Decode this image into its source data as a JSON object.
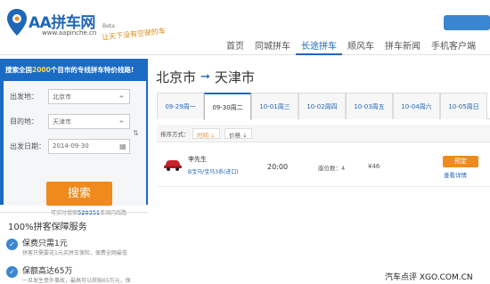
{
  "header": {
    "logo_name": "AA拼车网",
    "logo_url": "www.aapinche.cn",
    "beta": "Beta",
    "slogan": "让天下没有空驶的车",
    "nav": [
      "首页",
      "同城拼车",
      "长途拼车",
      "顺风车",
      "拼车新闻",
      "手机客户端"
    ],
    "active_nav": "长途拼车"
  },
  "sidebar": {
    "title_pre": "搜索全国",
    "title_num": "2000",
    "title_post": "个目市的专线拼车特价线路!",
    "from_label": "出发地：",
    "from_value": "北京市",
    "to_label": "目的地：",
    "to_value": "天津市",
    "date_label": "出发日期：",
    "date_value": "2014-09-30",
    "search_label": "搜索",
    "note_pre": "可实时搜索",
    "note_num": "520351",
    "note_post": "条国内线路"
  },
  "guarantee": {
    "title": "100%拼客保障服务",
    "items": [
      {
        "head": "保费只需1元",
        "sub": "拼客只需要花1元买拼车保险，保费全网最低"
      },
      {
        "head": "保额高达65万",
        "sub": "一旦发生意外事故，最高可以获赔65万元，保"
      }
    ]
  },
  "route": {
    "from": "北京市",
    "to": "天津市"
  },
  "dates": [
    "09-29周一",
    "09-30周二",
    "10-01周三",
    "10-02周四",
    "10-03周五",
    "10-04周六",
    "10-05周日"
  ],
  "active_date": "09-30周二",
  "sort": {
    "label": "排序方式：",
    "time": "时间 ⇣",
    "price": "价格 ⇣"
  },
  "listing": {
    "driver": "李先生",
    "vehicle": "B宝马/宝马3系(进口)",
    "time": "20:00",
    "seats": "座位数：4",
    "price": "¥46",
    "book": "预定",
    "detail": "查看详情"
  },
  "watermark": "汽车点评 XGO.COM.CN",
  "colors": {
    "brand_blue": "#1a6bc4",
    "accent_orange": "#f08a1c"
  }
}
